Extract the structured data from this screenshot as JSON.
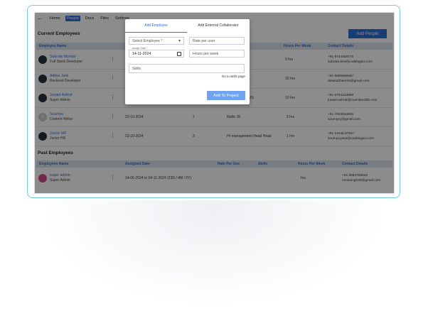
{
  "nav": {
    "back": "←",
    "items": [
      "Home",
      "People",
      "Docs",
      "Files",
      "Settings"
    ],
    "active": "People"
  },
  "current": {
    "title": "Current Employees",
    "add_button": "Add People",
    "headers": [
      "Employee Name",
      "Hours Per Week",
      "Contact Details"
    ],
    "rows": [
      {
        "name": "Subrata Mondal",
        "role": "Full Stack Developer",
        "date": "",
        "hours_pu": "",
        "lang": "",
        "hours": "0 hrs",
        "phone": "+91 9744458776",
        "email": "subrata.test@codelogics.com"
      },
      {
        "name": "Aditya Jaisi",
        "role": "Backend Developer",
        "date": "",
        "hours_pu": "",
        "lang": "",
        "hours": "10 hrs",
        "phone": "+91 8885556667",
        "email": "dutasubham25@gmail.com"
      },
      {
        "name": "Junaid Ashraf",
        "role": "Super Admin",
        "date": "",
        "hours_pu": "",
        "lang": "JS",
        "hours": "10 hrs",
        "phone": "+91 8754123589",
        "email": "junaid.ashraf@inventtechlib.com"
      },
      {
        "name": "Soumya",
        "role": "Content Writer",
        "date": "23-10-2024",
        "hours_pu": "1",
        "lang": "Node JS",
        "hours": "2 hrs",
        "phone": "+91 7003034825",
        "email": "soumya.j@gmail.com"
      },
      {
        "name": "Junior HR",
        "role": "Junior HR",
        "date": "23-10-2024",
        "hours_pu": "3",
        "lang": "Hr management Head Head",
        "hours": "1 hrs",
        "phone": "+91 12345 67847",
        "email": "soumya.jana@codelogics.com"
      }
    ]
  },
  "past": {
    "title": "Past Employees",
    "headers": [
      "Employees Name",
      "Assigned Date",
      "Rate Per Use",
      "Skills",
      "Hours Per Week",
      "Contact Details"
    ],
    "rows": [
      {
        "name": "super admin",
        "role": "Super Admin",
        "date": "14-06-2024 to 04-11-2024 (23D / 4M / 0Y)",
        "hours": "hrs",
        "phone": "+91 9854789533",
        "email": "mmsuingh25@gmail.com"
      }
    ]
  },
  "modal": {
    "tab_active": "Add Employee",
    "tab_inactive": "Add External Collaborator",
    "select_employee": "Select Employee *",
    "rate_placeholder": "Rate per user",
    "assign_date_label": "Assign Date *",
    "assign_date": "14-11-2024",
    "hours_placeholder": "Hours per week",
    "skills_placeholder": "Skills",
    "goto_skills": "Go to skills page",
    "submit": "Add To Project"
  },
  "colors": {
    "accent": "#2f6fd6",
    "frame": "#6ecfd6",
    "submit": "#6fa2ef"
  }
}
